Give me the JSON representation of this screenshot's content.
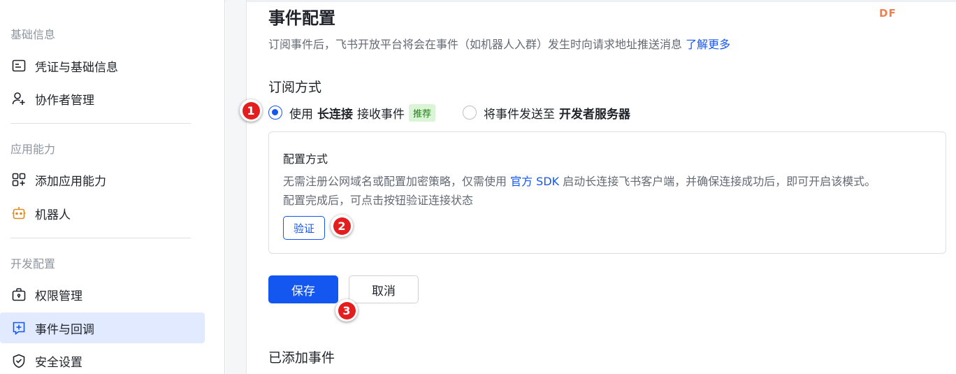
{
  "sidebar": {
    "sections": [
      {
        "title": "基础信息",
        "items": [
          {
            "label": "凭证与基础信息",
            "icon": "credential-card-icon"
          },
          {
            "label": "协作者管理",
            "icon": "add-user-icon"
          }
        ]
      },
      {
        "title": "应用能力",
        "items": [
          {
            "label": "添加应用能力",
            "icon": "app-grid-plus-icon"
          },
          {
            "label": "机器人",
            "icon": "robot-icon",
            "icon_color": "#d98b1e"
          }
        ]
      },
      {
        "title": "开发配置",
        "items": [
          {
            "label": "权限管理",
            "icon": "briefcase-lock-icon"
          },
          {
            "label": "事件与回调",
            "icon": "event-plus-icon",
            "active": true
          },
          {
            "label": "安全设置",
            "icon": "shield-check-icon"
          }
        ]
      }
    ]
  },
  "main": {
    "title": "事件配置",
    "description": "订阅事件后，飞书开放平台将会在事件（如机器人入群）发生时向请求地址推送消息",
    "learn_more": "了解更多",
    "watermark": "DF",
    "subscription": {
      "label": "订阅方式",
      "options": [
        {
          "prefix": "使用",
          "bold": "长连接",
          "suffix": "接收事件",
          "tag": "推荐",
          "checked": true
        },
        {
          "prefix": "将事件发送至",
          "bold": "开发者服务器",
          "suffix": "",
          "checked": false
        }
      ]
    },
    "config_box": {
      "title": "配置方式",
      "desc_before_link": "无需注册公网域名或配置加密策略，仅需使用 ",
      "desc_link": "官方 SDK",
      "desc_after_link": " 启动长连接飞书客户端，并确保连接成功后，即可开启该模式。",
      "desc_line2": "配置完成后，可点击按钮验证连接状态",
      "verify_label": "验证"
    },
    "save_label": "保存",
    "cancel_label": "取消",
    "added_events_title": "已添加事件"
  },
  "annotations": {
    "step1": "1",
    "step2": "2",
    "step3": "3",
    "badge_color": "#e41e1e"
  },
  "colors": {
    "accent": "#1456f0",
    "active_bg": "#e1eaff",
    "tag_bg": "#d9f5d6",
    "tag_fg": "#237b19"
  }
}
